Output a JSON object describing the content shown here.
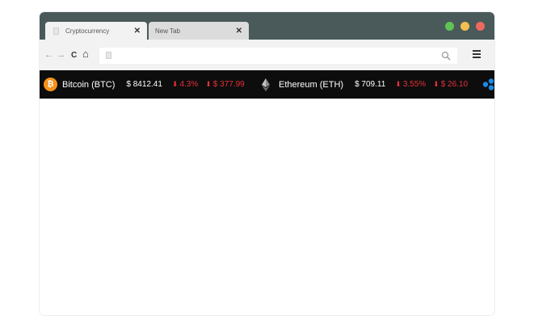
{
  "browser": {
    "tabs": [
      {
        "label": "Cryptocurrency",
        "close": "✕"
      },
      {
        "label": "New Tab",
        "close": "✕"
      }
    ],
    "traffic_lights": {
      "green": "#5fc454",
      "yellow": "#f4bf4f",
      "red": "#ee6a5f"
    },
    "toolbar": {
      "back": "←",
      "forward": "→",
      "reload": "C",
      "home": "⌂",
      "url_value": "",
      "url_placeholder": ""
    }
  },
  "ticker": [
    {
      "icon": "bitcoin-icon",
      "name": "Bitcoin (BTC)",
      "price": "$ 8412.41",
      "change_pct": "4.3%",
      "change_abs": "$ 377.99",
      "direction": "down"
    },
    {
      "icon": "ethereum-icon",
      "name": "Ethereum (ETH)",
      "price": "$ 709.11",
      "change_pct": "3.55%",
      "change_abs": "$ 26.10",
      "direction": "down"
    }
  ],
  "colors": {
    "ticker_bg": "#0d0d0d",
    "down": "#e8303a",
    "btc": "#f7931a",
    "xrp": "#1a8ae5"
  }
}
